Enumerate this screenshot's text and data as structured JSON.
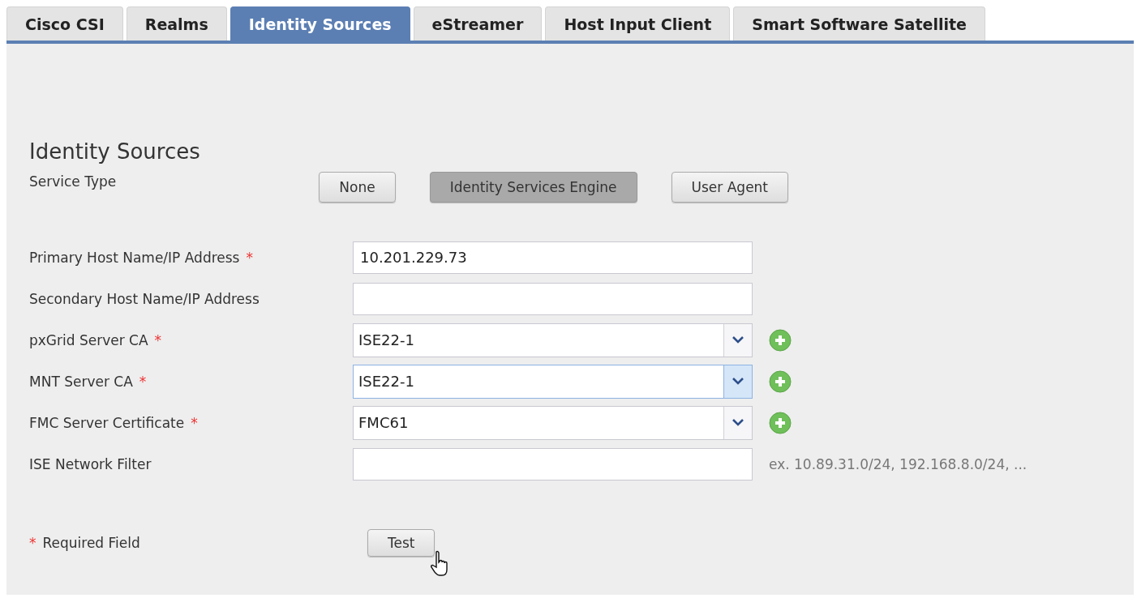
{
  "tabs": [
    {
      "label": "Cisco CSI",
      "selected": false
    },
    {
      "label": "Realms",
      "selected": false
    },
    {
      "label": "Identity Sources",
      "selected": true
    },
    {
      "label": "eStreamer",
      "selected": false
    },
    {
      "label": "Host Input Client",
      "selected": false
    },
    {
      "label": "Smart Software Satellite",
      "selected": false
    }
  ],
  "section_title": "Identity Sources",
  "service_type": {
    "label": "Service Type",
    "options": [
      {
        "label": "None",
        "selected": false
      },
      {
        "label": "Identity Services Engine",
        "selected": true
      },
      {
        "label": "User Agent",
        "selected": false
      }
    ]
  },
  "fields": [
    {
      "kind": "text",
      "label": "Primary Host Name/IP Address",
      "required": true,
      "value": "10.201.229.73"
    },
    {
      "kind": "text",
      "label": "Secondary Host Name/IP Address",
      "required": false
    },
    {
      "kind": "select",
      "label": "pxGrid Server CA",
      "required": true,
      "value": "ISE22-1",
      "focused": false
    },
    {
      "kind": "select",
      "label": "MNT Server CA",
      "required": true,
      "value": "ISE22-1",
      "focused": true
    },
    {
      "kind": "select",
      "label": "FMC Server Certificate",
      "required": true,
      "value": "FMC61",
      "focused": false
    },
    {
      "kind": "text",
      "label": "ISE Network Filter",
      "required": false,
      "hint": "ex. 10.89.31.0/24, 192.168.8.0/24, ..."
    }
  ],
  "required_note": {
    "mark": "*",
    "label": "Required Field"
  },
  "required_mark": "*",
  "test_button": "Test"
}
